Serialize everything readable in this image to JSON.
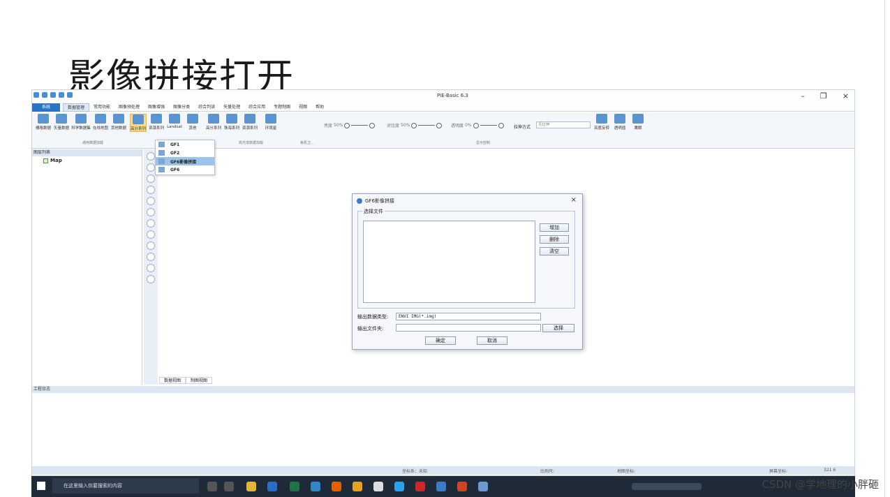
{
  "slide": {
    "title": "影像拼接打开"
  },
  "app": {
    "title": "PIE-Basic 6.3"
  },
  "menubar": {
    "items": [
      "系统",
      "数据管理",
      "常用功能",
      "图像预处理",
      "图像增强",
      "图像分类",
      "综合判读",
      "矢量处理",
      "综合应用",
      "专题制图",
      "视图",
      "帮助"
    ]
  },
  "ribbon": {
    "buttons": [
      "栅格数据",
      "矢量数据",
      "科学数据集",
      "在线地图",
      "其他数据",
      "高分系列",
      "资源系列",
      "Landsat",
      "其他",
      "高分系列",
      "珠海系列",
      "资源系列",
      "环境星"
    ],
    "groups": [
      "通用数据加载",
      "高光谱数据加载",
      "板机卫...",
      "显示控制"
    ],
    "sliders": {
      "brightness": "亮度",
      "brightness_val": "50%",
      "contrast": "对比度",
      "contrast_val": "50%",
      "transparency": "透明度",
      "transparency_val": "0%"
    },
    "stretch_label": "拉伸方式",
    "stretch_value": "无拉伸",
    "right_buttons": [
      "亮度反转",
      "透明值",
      "鹰眼"
    ]
  },
  "layer_panel": {
    "header": "图层列表",
    "root": "Map"
  },
  "dropdown": {
    "items": [
      "GF1",
      "GF2",
      "GF6影像拼接",
      "GF6"
    ]
  },
  "view_tabs": [
    "数据视图",
    "制图视图"
  ],
  "log_panel": {
    "header": "工程日志"
  },
  "status": {
    "coord_system": "坐标系：未知",
    "scale": "比例尺:",
    "map_coord": "地图坐标:",
    "screen_coord": "屏幕坐标:",
    "screen_value": "321  6"
  },
  "dialog": {
    "title": "GF6影像拼接",
    "group": "选择文件",
    "add": "增加",
    "remove": "删除",
    "clear": "清空",
    "output_type_label": "输出数据类型:",
    "output_type_value": "ENVI IMG(*.img)",
    "output_folder_label": "输出文件夹:",
    "browse": "选择",
    "ok": "确定",
    "cancel": "取消"
  },
  "taskbar": {
    "search_placeholder": "在这里输入你要搜索的内容"
  },
  "watermark": "CSDN @学地理的小胖砸",
  "colors": {
    "accent": "#2b73c4",
    "highlight": "#f7d98a",
    "selected": "#9cc3ea"
  }
}
